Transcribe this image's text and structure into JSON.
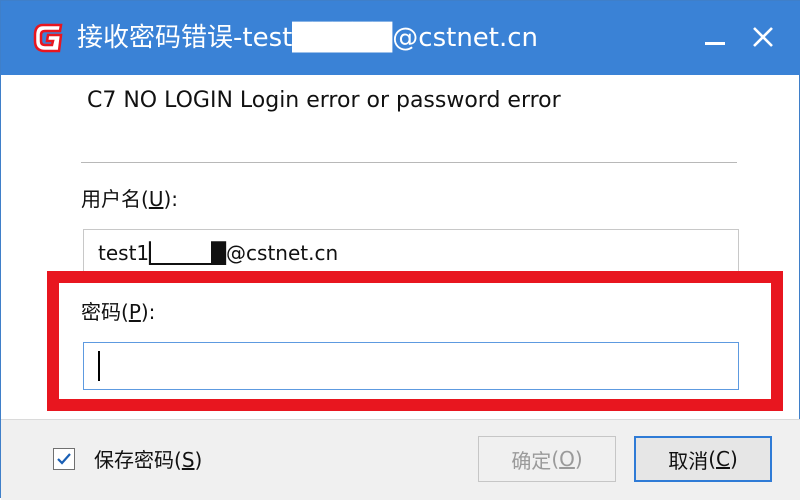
{
  "titlebar": {
    "title": "接收密码错误-test█████@cstnet.cn",
    "accent_color": "#3a82d6",
    "logo_icon": "red-g-logo-icon",
    "minimize_icon": "minimize-icon",
    "close_icon": "close-icon"
  },
  "message": {
    "text": "C7 NO LOGIN Login error or password error"
  },
  "username": {
    "label": "用户名",
    "mnemonic": "U",
    "value": "test1█████@cstnet.cn"
  },
  "password": {
    "label": "密码",
    "mnemonic": "P",
    "value": ""
  },
  "highlight": {
    "color": "#e8161f"
  },
  "footer": {
    "save_password_label": "保存密码",
    "save_password_mnemonic": "S",
    "save_password_checked": true,
    "ok_label": "确定",
    "ok_mnemonic": "O",
    "ok_enabled": false,
    "cancel_label": "取消",
    "cancel_mnemonic": "C"
  }
}
